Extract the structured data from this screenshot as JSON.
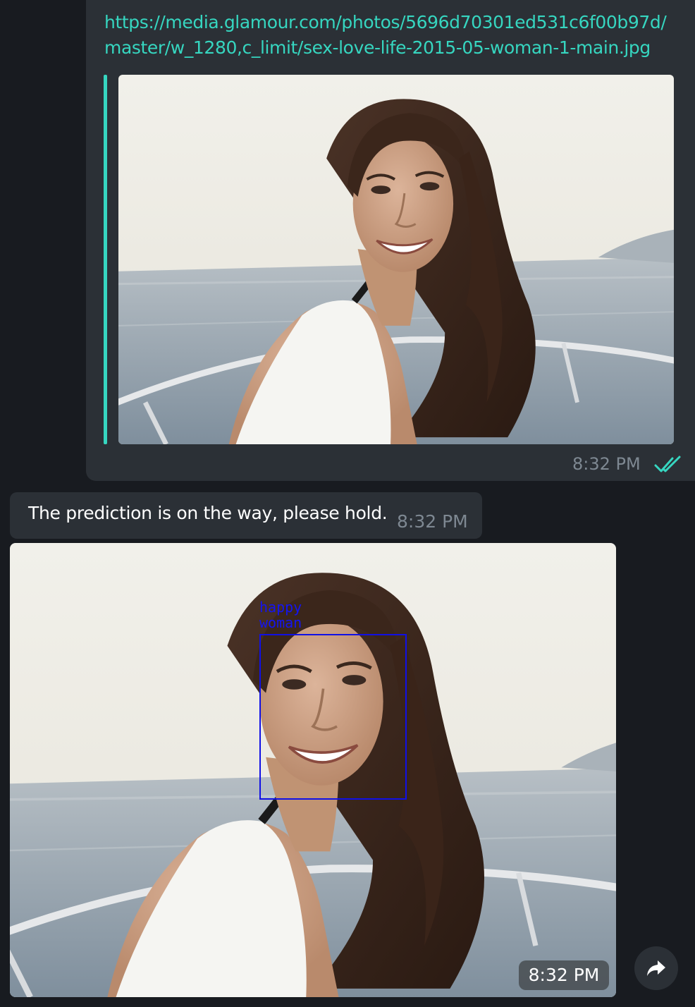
{
  "messages": {
    "link_message": {
      "url": "https://media.glamour.com/photos/5696d70301ed531c6f00b97d/master/w_1280,c_limit/sex-love-life-2015-05-woman-1-main.jpg",
      "time": "8:32 PM",
      "status_icon": "double-check-icon"
    },
    "reply_message": {
      "text": "The prediction is on the way, please hold.",
      "time": "8:32 PM"
    },
    "prediction_image": {
      "label": "happy\nwoman",
      "time": "8:32 PM",
      "forward_icon": "forward-arrow-icon"
    }
  },
  "colors": {
    "background": "#181b20",
    "bubble": "#2b3036",
    "accent": "#36d6c0",
    "timestamp": "#7e8892",
    "prediction_box": "#1010e6"
  }
}
